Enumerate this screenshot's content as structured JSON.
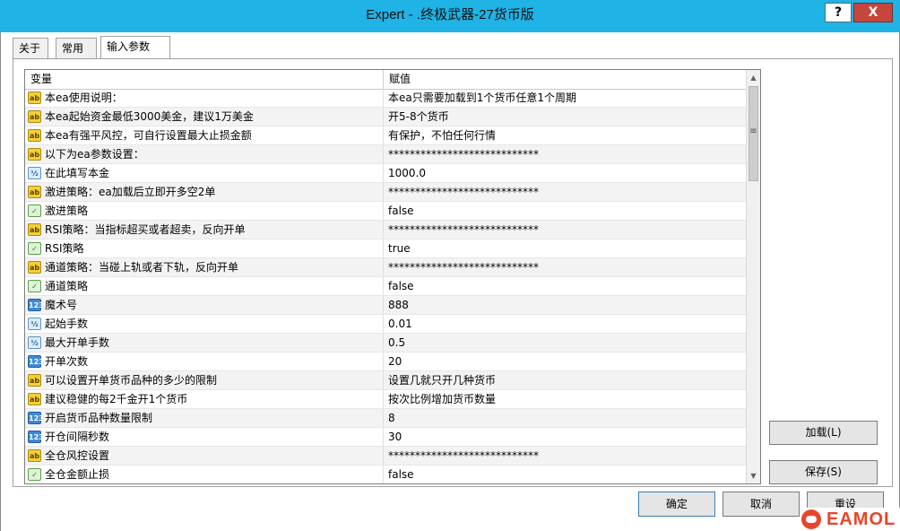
{
  "window": {
    "title": "Expert - .终极武器-27货币版",
    "help_label": "?",
    "close_label": "X"
  },
  "tabs": [
    "关于",
    "常用",
    "输入参数"
  ],
  "active_tab": 2,
  "table": {
    "headers": [
      "变量",
      "赋值"
    ],
    "rows": [
      {
        "type": "string",
        "icon": "ab",
        "var": "本ea使用说明：",
        "value": "本ea只需要加载到1个货币任意1个周期"
      },
      {
        "type": "string",
        "icon": "ab",
        "var": "本ea起始资金最低3000美金，建议1万美金",
        "value": "开5-8个货币"
      },
      {
        "type": "string",
        "icon": "ab",
        "var": "本ea有强平风控，可自行设置最大止损金额",
        "value": "有保护，不怕任何行情"
      },
      {
        "type": "string",
        "icon": "ab",
        "var": "以下为ea参数设置：",
        "value": "****************************"
      },
      {
        "type": "double",
        "icon": "½",
        "var": "在此填写本金",
        "value": "1000.0"
      },
      {
        "type": "string",
        "icon": "ab",
        "var": "激进策略：ea加载后立即开多空2单",
        "value": "****************************"
      },
      {
        "type": "bool",
        "icon": "✓",
        "var": "激进策略",
        "value": "false"
      },
      {
        "type": "string",
        "icon": "ab",
        "var": "RSI策略：当指标超买或者超卖，反向开单",
        "value": "****************************"
      },
      {
        "type": "bool",
        "icon": "✓",
        "var": "RSI策略",
        "value": "true"
      },
      {
        "type": "string",
        "icon": "ab",
        "var": "通道策略：当碰上轨或者下轨，反向开单",
        "value": "****************************"
      },
      {
        "type": "bool",
        "icon": "✓",
        "var": "通道策略",
        "value": "false"
      },
      {
        "type": "int",
        "icon": "123",
        "var": "魔术号",
        "value": "888"
      },
      {
        "type": "double",
        "icon": "½",
        "var": "起始手数",
        "value": "0.01"
      },
      {
        "type": "double",
        "icon": "½",
        "var": "最大开单手数",
        "value": "0.5"
      },
      {
        "type": "int",
        "icon": "123",
        "var": "开单次数",
        "value": "20"
      },
      {
        "type": "string",
        "icon": "ab",
        "var": "可以设置开单货币品种的多少的限制",
        "value": "设置几就只开几种货币"
      },
      {
        "type": "string",
        "icon": "ab",
        "var": "建议稳健的每2千金开1个货币",
        "value": "按次比例增加货币数量"
      },
      {
        "type": "int",
        "icon": "123",
        "var": "开启货币品种数量限制",
        "value": "8"
      },
      {
        "type": "int",
        "icon": "123",
        "var": "开仓间隔秒数",
        "value": "30"
      },
      {
        "type": "string",
        "icon": "ab",
        "var": "全仓风控设置",
        "value": "****************************"
      },
      {
        "type": "bool",
        "icon": "✓",
        "var": "全仓金额止损",
        "value": "false"
      }
    ]
  },
  "scrollbar": {
    "up_icon": "▲",
    "down_icon": "▼",
    "grip_icon": "≡"
  },
  "buttons": {
    "load": "加载(L)",
    "save": "保存(S)",
    "ok": "确定",
    "cancel": "取消",
    "reset": "重设"
  },
  "watermark": {
    "text": "EAMOL"
  },
  "colors": {
    "titlebar": "#1fb3e6",
    "close": "#c7463b",
    "string_icon": "#f3cf3a",
    "int_icon": "#3d8ad6",
    "watermark": "#e8452a"
  }
}
